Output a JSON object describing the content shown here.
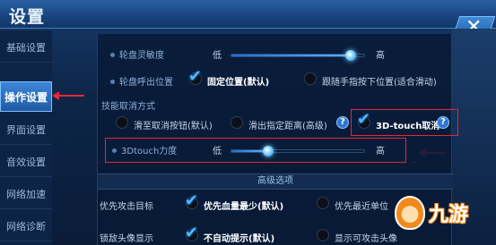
{
  "header": {
    "title": "设置",
    "close_icon": "close-icon"
  },
  "sidebar": {
    "items": [
      {
        "label": "基础设置",
        "active": false
      },
      {
        "label": "操作设置",
        "active": true
      },
      {
        "label": "界面设置",
        "active": false
      },
      {
        "label": "音效设置",
        "active": false
      },
      {
        "label": "网络加速",
        "active": false
      },
      {
        "label": "网络诊断",
        "active": false
      }
    ]
  },
  "settings": {
    "wheel_sensitivity": {
      "label": "轮盘灵敏度",
      "low": "低",
      "high": "高",
      "level": 0.9
    },
    "wheel_position": {
      "label": "轮盘呼出位置",
      "option_fixed": "固定位置(默认)",
      "option_follow": "跟随手指按下位置(适合滑动)",
      "selected": "fixed"
    },
    "skill_cancel": {
      "label": "技能取消方式",
      "option_button": "滑至取消按钮(默认)",
      "option_distance": "滑出指定距离(高级)",
      "option_3dtouch": "3D-touch取消",
      "selected": "3dtouch",
      "help": "?"
    },
    "touch_force": {
      "label": "3Dtouch力度",
      "low": "低",
      "high": "高",
      "level": 0.28
    }
  },
  "advanced": {
    "title": "高级选项",
    "attack_target": {
      "label": "优先攻击目标",
      "option_low_hp": "优先血量最少(默认)",
      "option_nearest": "优先最近单位",
      "selected": "low_hp"
    },
    "lock_avatar": {
      "label": "锁敌头像显示",
      "option_no_auto": "不自动提示(默认)",
      "option_show_attack": "显示可攻击头像",
      "selected": "no_auto"
    }
  },
  "watermark": {
    "text": "九游"
  },
  "colors": {
    "accent": "#3c86d9",
    "highlight": "#e6273a",
    "check": "#4fb6ff"
  }
}
